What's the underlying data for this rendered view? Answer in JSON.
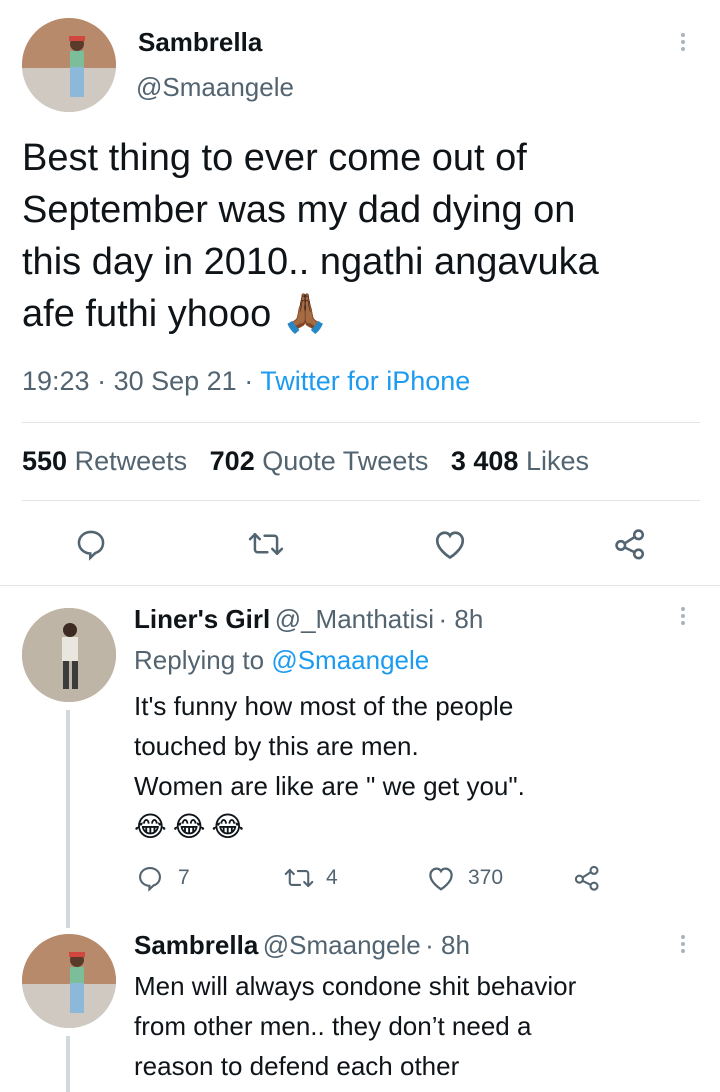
{
  "main_tweet": {
    "author_name": "Sambrella",
    "author_handle": "@Smaangele",
    "text_lines": [
      "Best thing to ever come out of",
      "September was my dad dying on",
      "this day in 2010.. ngathi angavuka",
      "afe futhi yhooo 🙏🏾"
    ],
    "time": "19:23",
    "date": "30 Sep 21",
    "source": "Twitter for iPhone",
    "retweets_count": "550",
    "retweets_label": "Retweets",
    "quotes_count": "702",
    "quotes_label": "Quote Tweets",
    "likes_count": "3 408",
    "likes_label": "Likes"
  },
  "replies": [
    {
      "author_name": "Liner's Girl",
      "author_handle": "@_Manthatisi",
      "age": "8h",
      "replying_to_label": "Replying to",
      "replying_to_handle": "@Smaangele",
      "text_lines": [
        "It's funny how most of the people",
        "touched by this are men.",
        "Women are like are \" we get you\"."
      ],
      "emoji_line": "😂😂😂",
      "reply_count": "7",
      "retweet_count": "4",
      "like_count": "370"
    },
    {
      "author_name": "Sambrella",
      "author_handle": "@Smaangele",
      "age": "8h",
      "text_lines": [
        "Men will always condone shit behavior",
        "from other men.. they don’t need a",
        "reason to defend each other"
      ]
    }
  ],
  "colors": {
    "accent": "#1d9bf0",
    "secondary_text": "#536471",
    "primary_text": "#0f1419",
    "divider": "#e1e5e8"
  },
  "icons": [
    "more-icon",
    "reply-icon",
    "retweet-icon",
    "like-icon",
    "share-icon"
  ]
}
